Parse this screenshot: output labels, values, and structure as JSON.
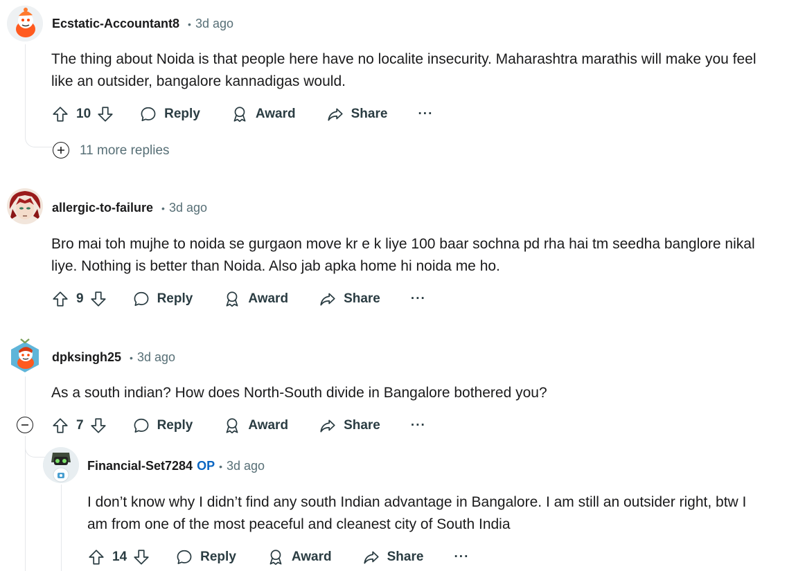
{
  "comments": [
    {
      "username": "Ecstatic-Accountant8",
      "time": "3d ago",
      "lines": [
        "The thing about Noida is that people here have no localite insecurity. Maharashtra marathis will make you feel",
        "like an outsider, bangalore kannadigas would."
      ],
      "votes": "10",
      "reply_label": "Reply",
      "award_label": "Award",
      "share_label": "Share",
      "more_replies": "11 more replies"
    },
    {
      "username": "allergic-to-failure",
      "time": "3d ago",
      "lines": [
        "Bro mai toh mujhe to noida se gurgaon move kr e k liye 100 baar sochna pd rha hai tm seedha banglore nikal",
        "liye. Nothing is better than Noida. Also jab apka home hi noida me ho."
      ],
      "votes": "9",
      "reply_label": "Reply",
      "award_label": "Award",
      "share_label": "Share"
    },
    {
      "username": "dpksingh25",
      "time": "3d ago",
      "lines": [
        "As a south indian? How does North-South divide in Bangalore bothered you?"
      ],
      "votes": "7",
      "reply_label": "Reply",
      "award_label": "Award",
      "share_label": "Share"
    },
    {
      "username": "Financial-Set7284",
      "op_badge": "OP",
      "time": "3d ago",
      "lines": [
        "I don’t know why I didn’t find any south Indian advantage in Bangalore. I am still an outsider right, btw I",
        "am from one of the most peaceful and cleanest city of South India"
      ],
      "votes": "14",
      "reply_label": "Reply",
      "award_label": "Award",
      "share_label": "Share"
    }
  ],
  "more_glyph": "···",
  "colors": {
    "text": "#1a1a1b",
    "meta": "#576f76",
    "op": "#0a66c2",
    "thread": "#e5e7ea"
  }
}
